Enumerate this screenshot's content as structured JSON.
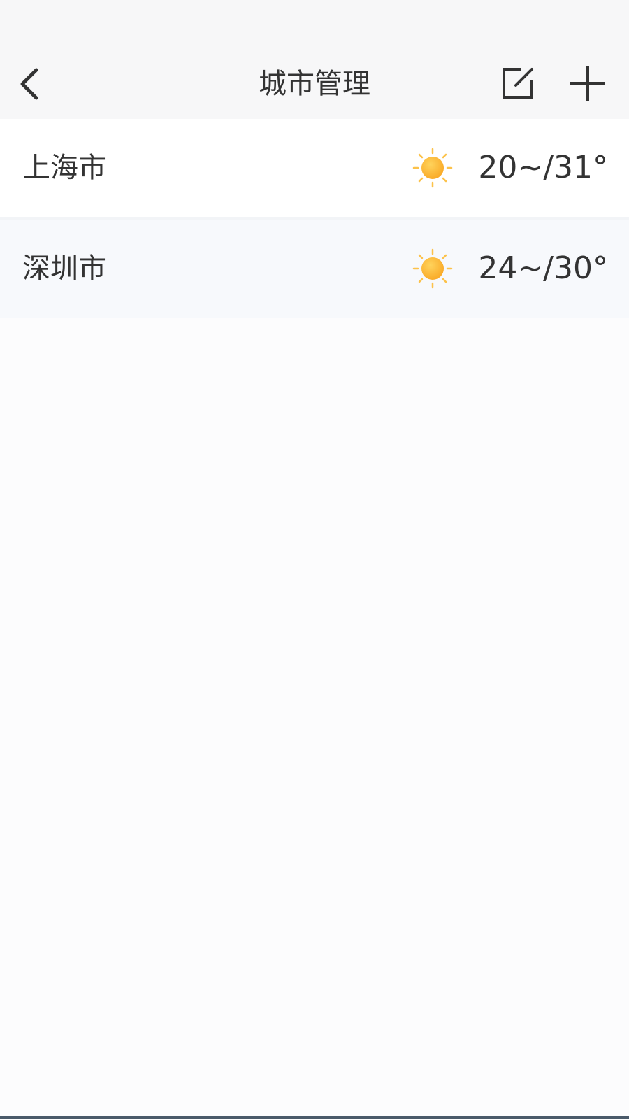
{
  "header": {
    "title": "城市管理",
    "back_icon": "chevron-left-icon",
    "edit_icon": "edit-square-icon",
    "add_icon": "plus-icon"
  },
  "cities": [
    {
      "name": "上海市",
      "temp": "20~/31°",
      "weather_icon": "sunny-icon"
    },
    {
      "name": "深圳市",
      "temp": "24~/30°",
      "weather_icon": "sunny-icon"
    }
  ],
  "colors": {
    "sun": "#fbb034",
    "text": "#333333",
    "background": "#fcfcfd"
  }
}
